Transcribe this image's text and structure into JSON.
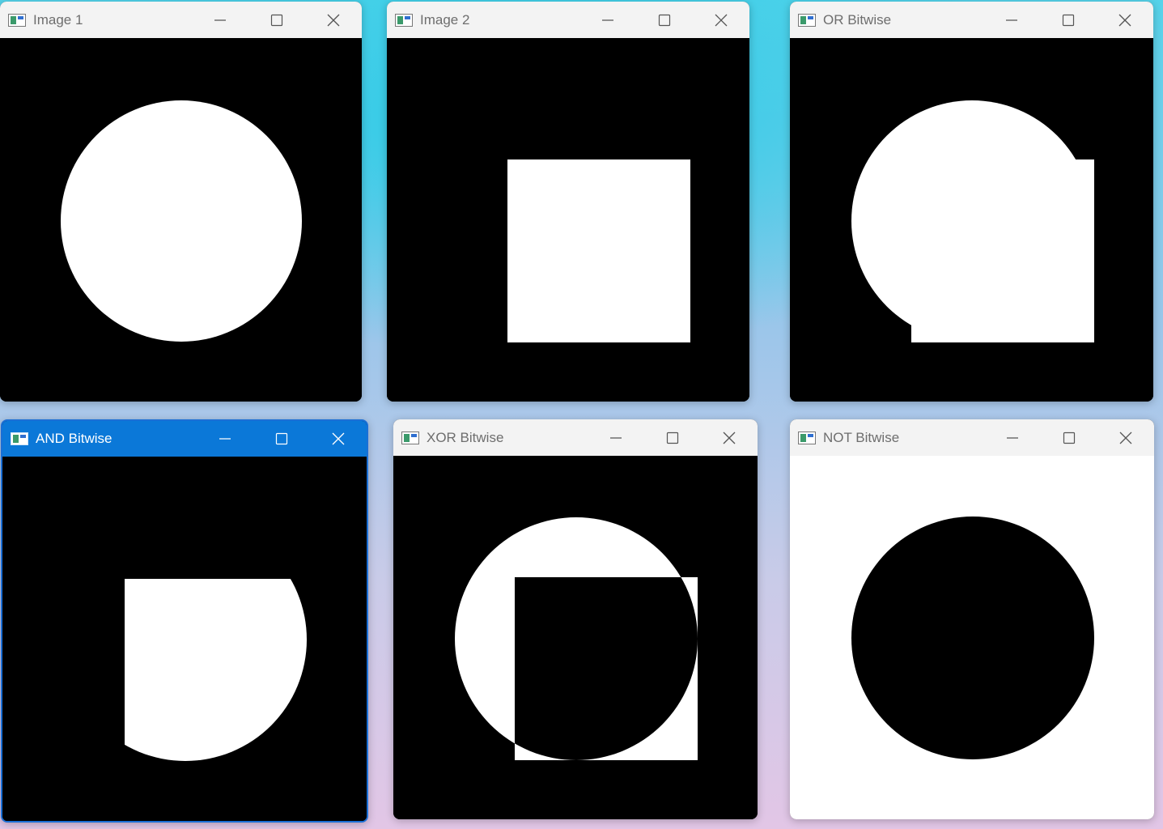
{
  "windows": [
    {
      "id": "image1",
      "title": "Image 1",
      "active": false,
      "content": "circle"
    },
    {
      "id": "image2",
      "title": "Image 2",
      "active": false,
      "content": "square"
    },
    {
      "id": "or",
      "title": "OR Bitwise",
      "active": false,
      "content": "or"
    },
    {
      "id": "and",
      "title": "AND Bitwise",
      "active": true,
      "content": "and"
    },
    {
      "id": "xor",
      "title": "XOR Bitwise",
      "active": false,
      "content": "xor"
    },
    {
      "id": "not",
      "title": "NOT Bitwise",
      "active": false,
      "content": "not"
    }
  ],
  "titlebar_buttons": [
    "minimize-icon",
    "maximize-icon",
    "close-icon"
  ],
  "colors": {
    "image_background": "#000000",
    "shape_fill": "#ffffff",
    "active_titlebar": "#0b78d8",
    "inactive_titlebar": "#f3f3f3"
  }
}
